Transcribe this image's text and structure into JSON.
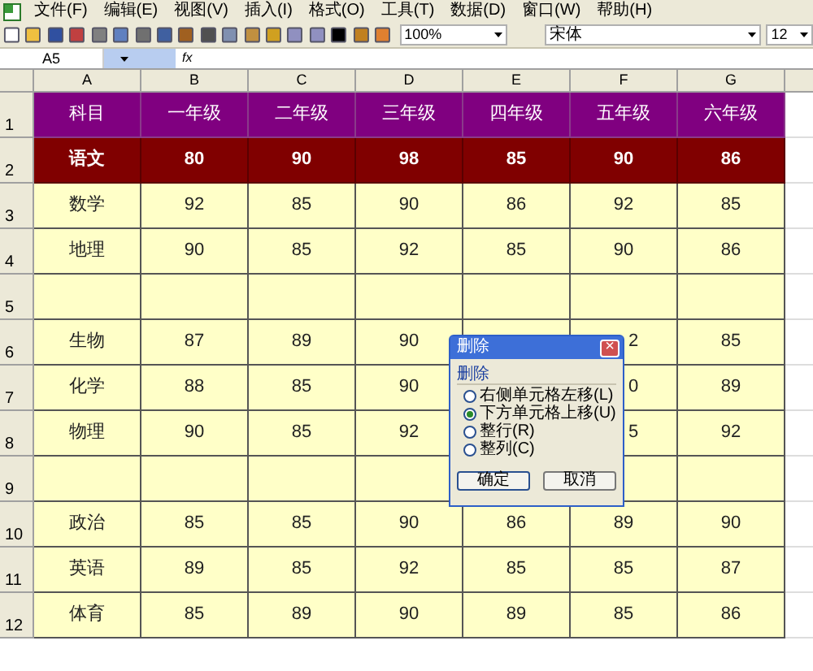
{
  "menu_bar": {
    "items": [
      "文件(F)",
      "编辑(E)",
      "视图(V)",
      "插入(I)",
      "格式(O)",
      "工具(T)",
      "数据(D)",
      "窗口(W)",
      "帮助(H)"
    ]
  },
  "toolbar": {
    "zoom": "100%",
    "font": "宋体",
    "font_size": "12"
  },
  "formula_bar": {
    "name_box": "A5",
    "fx": "fx"
  },
  "columns": [
    "A",
    "B",
    "C",
    "D",
    "E",
    "F",
    "G"
  ],
  "rows": [
    {
      "number": "1",
      "kind": "header",
      "cells": [
        "科目",
        "一年级",
        "二年级",
        "三年级",
        "四年级",
        "五年级",
        "六年级"
      ]
    },
    {
      "number": "2",
      "kind": "highlight",
      "cells": [
        "语文",
        "80",
        "90",
        "98",
        "85",
        "90",
        "86"
      ]
    },
    {
      "number": "3",
      "kind": "normal",
      "cells": [
        "数学",
        "92",
        "85",
        "90",
        "86",
        "92",
        "85"
      ]
    },
    {
      "number": "4",
      "kind": "normal",
      "cells": [
        "地理",
        "90",
        "85",
        "92",
        "85",
        "90",
        "86"
      ]
    },
    {
      "number": "5",
      "kind": "normal",
      "cells": [
        null,
        null,
        null,
        null,
        null,
        null,
        null
      ]
    },
    {
      "number": "6",
      "kind": "normal",
      "cells": [
        "生物",
        "87",
        "89",
        "90",
        null,
        {
          "text": "2",
          "clipped": true
        },
        "85"
      ]
    },
    {
      "number": "7",
      "kind": "normal",
      "cells": [
        "化学",
        "88",
        "85",
        "90",
        false,
        {
          "text": "0",
          "clipped": true
        },
        "89"
      ]
    },
    {
      "number": "8",
      "kind": "normal",
      "cells": [
        "物理",
        "90",
        "85",
        "92",
        false,
        {
          "text": "5",
          "clipped": true
        },
        "92"
      ]
    },
    {
      "number": "9",
      "kind": "normal",
      "cells": [
        null,
        null,
        null,
        null,
        null,
        null,
        null
      ]
    },
    {
      "number": "10",
      "kind": "normal",
      "cells": [
        "政治",
        "85",
        "85",
        "90",
        "86",
        "89",
        "90"
      ]
    },
    {
      "number": "11",
      "kind": "normal",
      "cells": [
        "英语",
        "89",
        "85",
        "92",
        "85",
        "85",
        "87"
      ]
    },
    {
      "number": "12",
      "kind": "normal",
      "cells": [
        "体育",
        "85",
        "89",
        "90",
        "89",
        "85",
        "86"
      ]
    }
  ],
  "dialog": {
    "title": "删除",
    "close": "×",
    "group": "删除",
    "options": [
      {
        "label": "右侧单元格左移(L)",
        "selected": false
      },
      {
        "label": "下方单元格上移(U)",
        "selected": true
      },
      {
        "label": "整行(R)",
        "selected": false
      },
      {
        "label": "整列(C)",
        "selected": false
      }
    ],
    "buttons": [
      {
        "label": "确定",
        "default": true
      },
      {
        "label": "取消",
        "default": false
      }
    ]
  }
}
